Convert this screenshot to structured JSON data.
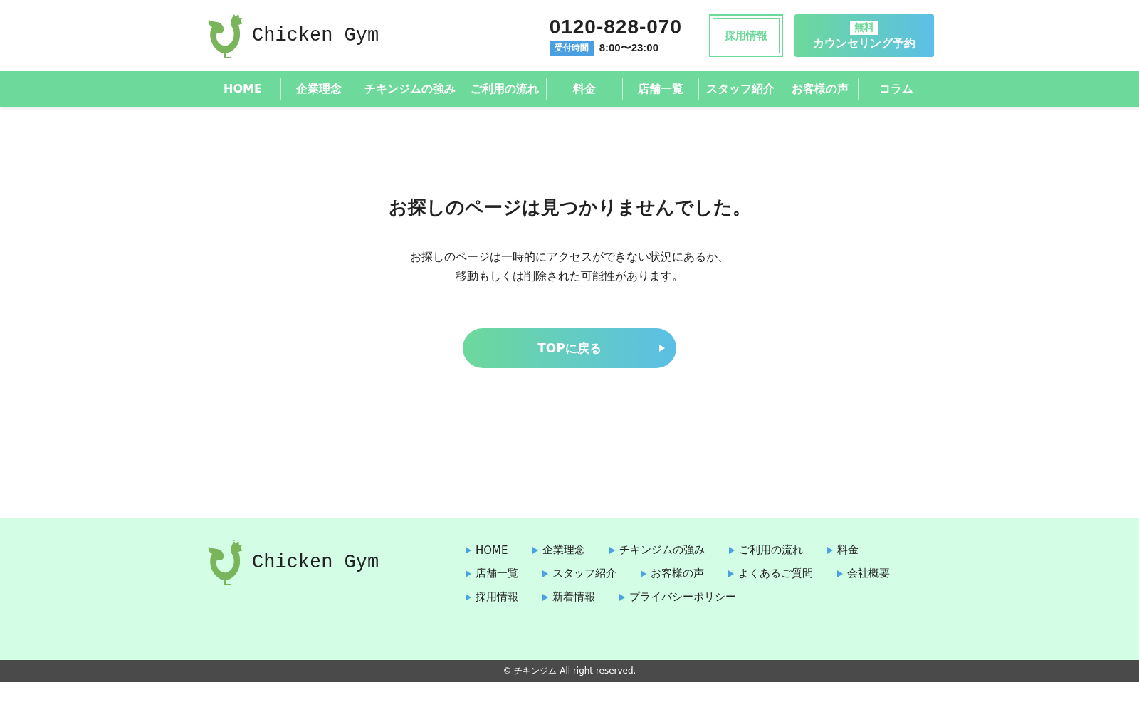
{
  "header": {
    "logo_text": "Chicken Gym",
    "phone": "0120-828-070",
    "hours_label": "受付時間",
    "hours": "8:00〜23:00",
    "recruit_button": "採用情報",
    "counseling_badge": "無料",
    "counseling_button": "カウンセリング予約"
  },
  "nav": [
    "HOME",
    "企業理念",
    "チキンジムの強み",
    "ご利用の流れ",
    "料金",
    "店舗一覧",
    "スタッフ紹介",
    "お客様の声",
    "コラム"
  ],
  "main": {
    "heading": "お探しのページは見つかりませんでした。",
    "message": [
      "お探しのページは一時的にアクセスができない状況にあるか、",
      "移動もしくは削除された可能性があります。"
    ],
    "top_button": "TOPに戻る"
  },
  "footer": {
    "logo_text": "Chicken Gym",
    "links": [
      [
        "HOME",
        "企業理念",
        "チキンジムの強み",
        "ご利用の流れ",
        "料金"
      ],
      [
        "店舗一覧",
        "スタッフ紹介",
        "お客様の声",
        "よくあるご質問",
        "会社概要"
      ],
      [
        "採用情報",
        "新着情報",
        "プライバシーポリシー"
      ]
    ]
  },
  "copyright": "© チキンジム All right reserved."
}
